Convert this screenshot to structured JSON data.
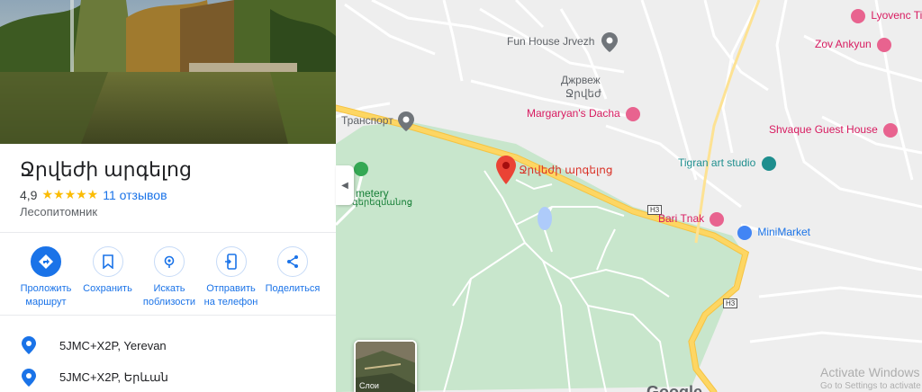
{
  "place": {
    "title": "Ջրվեժի արգելոց",
    "rating": "4,9",
    "stars": "★★★★★",
    "reviews": "11 отзывов",
    "category": "Лесопитомник"
  },
  "actions": [
    {
      "label1": "Проложить",
      "label2": "маршрут"
    },
    {
      "label1": "Сохранить",
      "label2": ""
    },
    {
      "label1": "Искать",
      "label2": "поблизости"
    },
    {
      "label1": "Отправить",
      "label2": "на телефон"
    },
    {
      "label1": "Поделиться",
      "label2": ""
    }
  ],
  "info": [
    {
      "text": "5JMC+X2P, Yerevan"
    },
    {
      "text": "5JMC+X2P, Երևան"
    }
  ],
  "map": {
    "place_pin_label": "Ջրվեժի արգելոց",
    "pois": {
      "fun_house": "Fun House Jrvezh",
      "jrvezh_ru": "Джрвеж",
      "jrvezh_hy": "Ջրվեժ",
      "margaryan": "Margaryan's Dacha",
      "transport": "Транспорт",
      "lyovenc": "Lyovenc Ti",
      "zov": "Zov Ankyun",
      "shvaque": "Shvaque Guest House",
      "tigran": "Tigran art studio",
      "bari": "Bari Tnak",
      "minimarket": "MiniMarket",
      "cemetery": "metery",
      "cemetery_hy": "գերեզմանոց"
    },
    "road_tags": [
      "H3",
      "H3",
      "H3"
    ],
    "layers_label": "Слои",
    "google": "Google",
    "colors": {
      "park": "#c8e6cc",
      "road_major": "#fdd663",
      "pin": "#ea4335",
      "accent": "#1a73e8"
    }
  },
  "os": {
    "activate_title": "Activate Windows",
    "activate_sub": "Go to Settings to activate Windows."
  }
}
